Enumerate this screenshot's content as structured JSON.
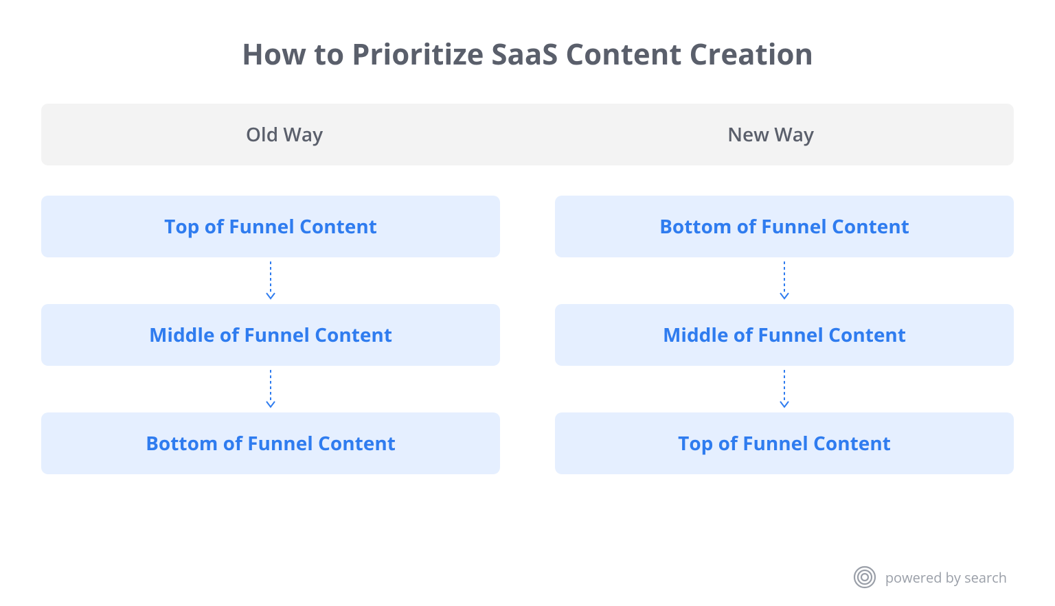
{
  "title": "How to Prioritize SaaS Content Creation",
  "columns": {
    "old": {
      "label": "Old Way",
      "steps": [
        "Top of Funnel Content",
        "Middle of Funnel Content",
        "Bottom of Funnel Content"
      ]
    },
    "new": {
      "label": "New Way",
      "steps": [
        "Bottom of Funnel Content",
        "Middle of Funnel Content",
        "Top of Funnel Content"
      ]
    }
  },
  "footer": {
    "brand": "powered by search"
  },
  "colors": {
    "box_bg": "#e5efff",
    "box_text": "#2f7cef",
    "header_bg": "#f3f3f3",
    "heading": "#5a5f6b",
    "arrow": "#2f7cef",
    "footer": "#9a9fa8"
  }
}
